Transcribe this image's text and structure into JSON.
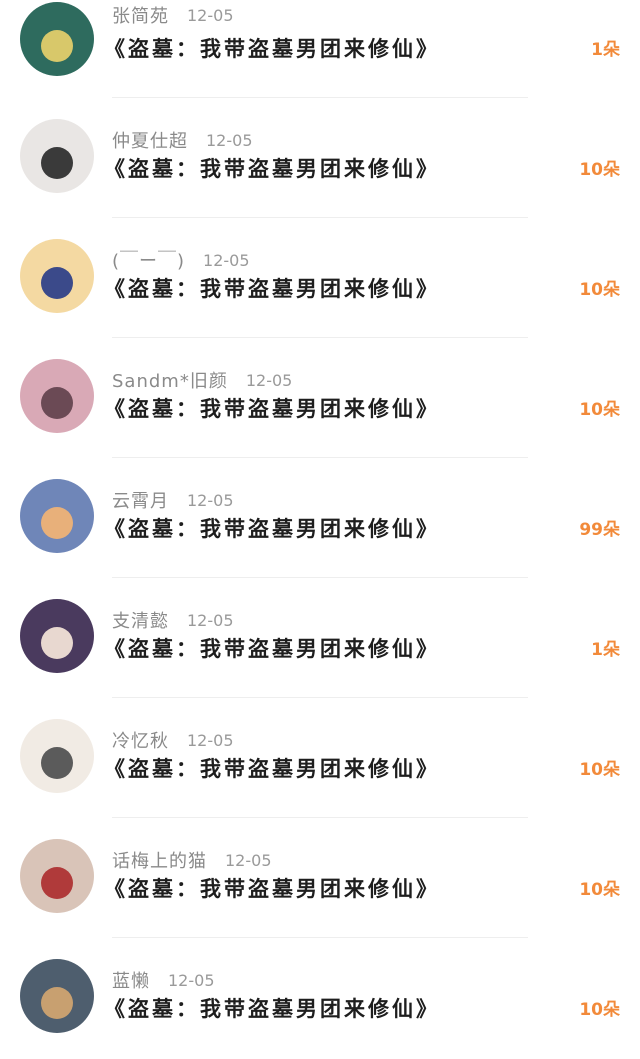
{
  "items": [
    {
      "name": "张简苑",
      "date": "12-05",
      "title": "《盗墓：我带盗墓男团来修仙》",
      "gift": "1朵",
      "avatar_color": "#2e6b5e",
      "avatar_accent": "#d8c86a"
    },
    {
      "name": "仲夏仕超",
      "date": "12-05",
      "title": "《盗墓：我带盗墓男团来修仙》",
      "gift": "10朵",
      "avatar_color": "#e9e6e4",
      "avatar_accent": "#3a3a3a"
    },
    {
      "name": "(￣ー￣)",
      "date": "12-05",
      "title": "《盗墓：我带盗墓男团来修仙》",
      "gift": "10朵",
      "avatar_color": "#f4d9a2",
      "avatar_accent": "#3b4a8a"
    },
    {
      "name": "Sandm*旧颜",
      "date": "12-05",
      "title": "《盗墓：我带盗墓男团来修仙》",
      "gift": "10朵",
      "avatar_color": "#d9a9b6",
      "avatar_accent": "#6b4a55"
    },
    {
      "name": "云霄月",
      "date": "12-05",
      "title": "《盗墓：我带盗墓男团来修仙》",
      "gift": "99朵",
      "avatar_color": "#6f86b8",
      "avatar_accent": "#e8b07a"
    },
    {
      "name": "支清懿",
      "date": "12-05",
      "title": "《盗墓：我带盗墓男团来修仙》",
      "gift": "1朵",
      "avatar_color": "#4a3a5e",
      "avatar_accent": "#e8d8d0"
    },
    {
      "name": "冷忆秋",
      "date": "12-05",
      "title": "《盗墓：我带盗墓男团来修仙》",
      "gift": "10朵",
      "avatar_color": "#f1ebe4",
      "avatar_accent": "#5b5b5b"
    },
    {
      "name": "话梅上的猫",
      "date": "12-05",
      "title": "《盗墓：我带盗墓男团来修仙》",
      "gift": "10朵",
      "avatar_color": "#d9c4b8",
      "avatar_accent": "#b03a3a"
    },
    {
      "name": "蓝懒",
      "date": "12-05",
      "title": "《盗墓：我带盗墓男团来修仙》",
      "gift": "10朵",
      "avatar_color": "#4e5e6e",
      "avatar_accent": "#c8a070"
    }
  ]
}
